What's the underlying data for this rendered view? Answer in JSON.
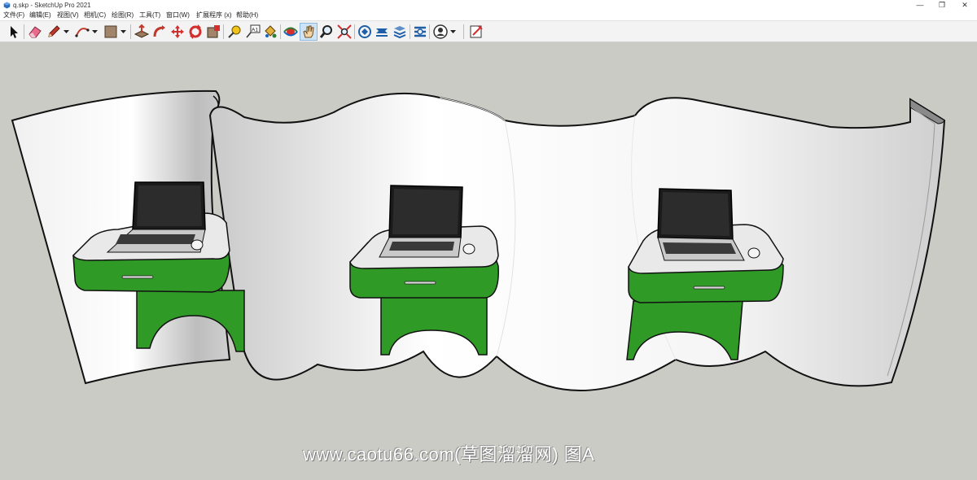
{
  "window": {
    "title": "q.skp - SketchUp Pro 2021",
    "controls": {
      "minimize": "—",
      "restore": "❐",
      "close": "✕"
    }
  },
  "menu": {
    "items": [
      {
        "label": "文件(F)"
      },
      {
        "label": "编辑(E)"
      },
      {
        "label": "视图(V)"
      },
      {
        "label": "相机(C)"
      },
      {
        "label": "绘图(R)"
      },
      {
        "label": "工具(T)"
      },
      {
        "label": "窗口(W)"
      },
      {
        "label": "扩展程序 (x)"
      },
      {
        "label": "帮助(H)"
      }
    ]
  },
  "toolbar": {
    "tools": [
      {
        "icon": "select-arrow-icon"
      },
      {
        "icon": "eraser-icon"
      },
      {
        "icon": "pencil-line-icon"
      },
      {
        "icon": "arc-icon"
      },
      {
        "icon": "rectangle-icon"
      },
      {
        "icon": "push-pull-icon"
      },
      {
        "icon": "follow-me-icon"
      },
      {
        "icon": "move-icon"
      },
      {
        "icon": "rotate-icon"
      },
      {
        "icon": "scale-icon"
      },
      {
        "icon": "tape-measure-icon"
      },
      {
        "icon": "text-label-icon"
      },
      {
        "icon": "paint-bucket-icon"
      },
      {
        "icon": "orbit-icon"
      },
      {
        "icon": "pan-hand-icon",
        "active": true
      },
      {
        "icon": "zoom-icon"
      },
      {
        "icon": "zoom-extents-icon"
      },
      {
        "icon": "3d-warehouse-icon"
      },
      {
        "icon": "extension-warehouse-icon"
      },
      {
        "icon": "layout-icon"
      },
      {
        "icon": "extension-manager-icon"
      },
      {
        "icon": "account-icon"
      },
      {
        "icon": "section-plane-icon"
      }
    ],
    "text_tool_glyph": "A1"
  },
  "viewport": {
    "background": "#cbcbc6",
    "wall_fill": "#f7f7f7",
    "desk_color": "#2f9a26",
    "laptop_screen": "#1b1b1b"
  },
  "watermark": "www.caotu66.com(草图溜溜网) 图A"
}
